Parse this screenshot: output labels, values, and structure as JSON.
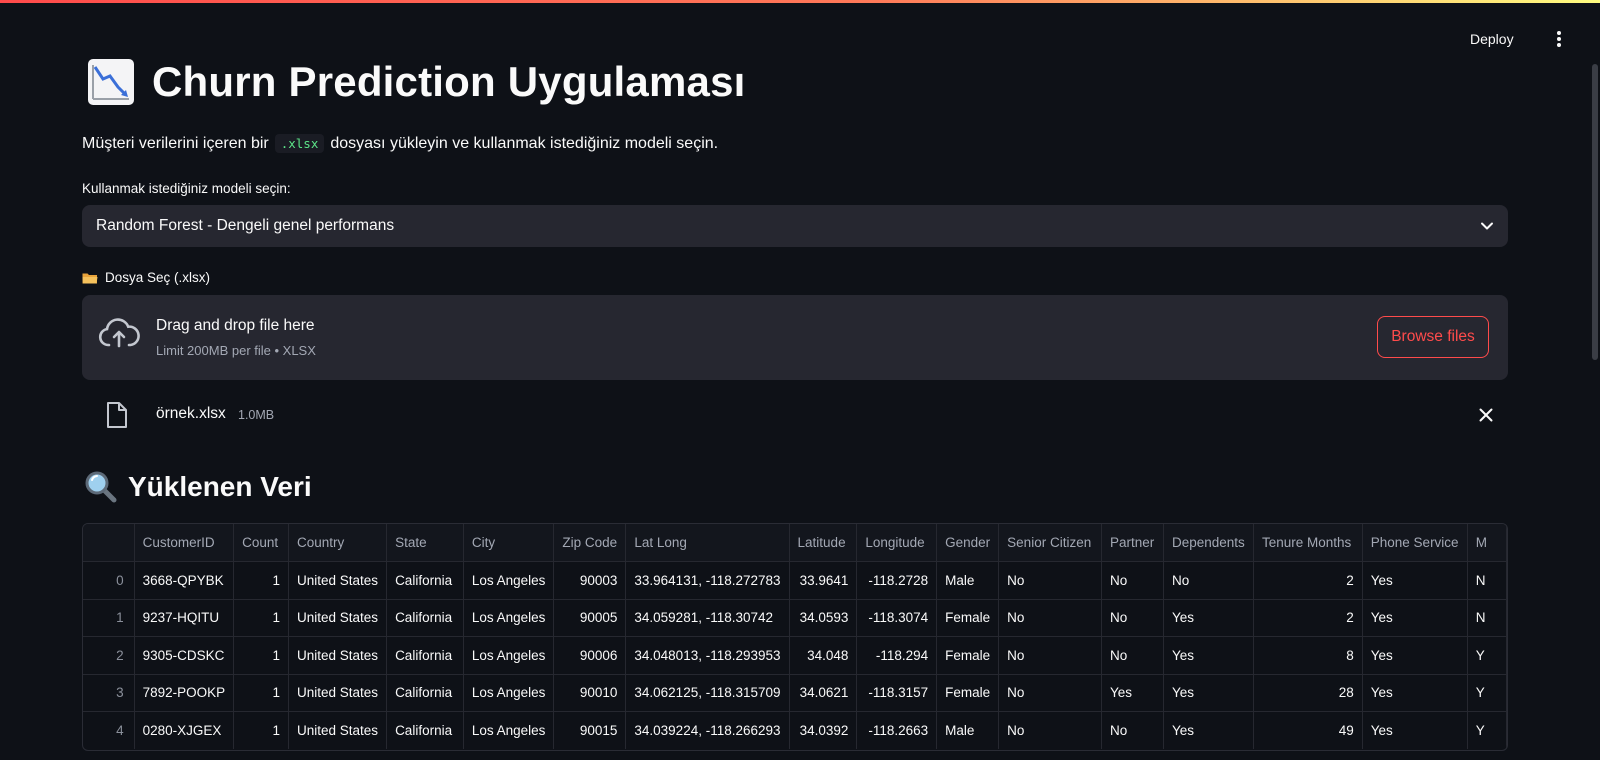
{
  "header": {
    "deploy_label": "Deploy"
  },
  "page": {
    "title": "Churn Prediction Uygulaması",
    "description_before": "Müşteri verilerini içeren bir",
    "description_code": ".xlsx",
    "description_after": "dosyası yükleyin ve kullanmak istediğiniz modeli seçin."
  },
  "model_select": {
    "label": "Kullanmak istediğiniz modeli seçin:",
    "selected": "Random Forest - Dengeli genel performans"
  },
  "uploader": {
    "label": "Dosya Seç (.xlsx)",
    "drop_title": "Drag and drop file here",
    "drop_sub": "Limit 200MB per file • XLSX",
    "browse_label": "Browse files",
    "file_name": "örnek.xlsx",
    "file_size": "1.0MB"
  },
  "data_section": {
    "title": "Yüklenen Veri"
  },
  "table": {
    "columns": [
      "",
      "CustomerID",
      "Count",
      "Country",
      "State",
      "City",
      "Zip Code",
      "Lat Long",
      "Latitude",
      "Longitude",
      "Gender",
      "Senior Citizen",
      "Partner",
      "Dependents",
      "Tenure Months",
      "Phone Service",
      "M"
    ],
    "rows": [
      [
        "0",
        "3668-QPYBK",
        "1",
        "United States",
        "California",
        "Los Angeles",
        "90003",
        "33.964131, -118.272783",
        "33.9641",
        "-118.2728",
        "Male",
        "No",
        "No",
        "No",
        "2",
        "Yes",
        "N"
      ],
      [
        "1",
        "9237-HQITU",
        "1",
        "United States",
        "California",
        "Los Angeles",
        "90005",
        "34.059281, -118.30742",
        "34.0593",
        "-118.3074",
        "Female",
        "No",
        "No",
        "Yes",
        "2",
        "Yes",
        "N"
      ],
      [
        "2",
        "9305-CDSKC",
        "1",
        "United States",
        "California",
        "Los Angeles",
        "90006",
        "34.048013, -118.293953",
        "34.048",
        "-118.294",
        "Female",
        "No",
        "No",
        "Yes",
        "8",
        "Yes",
        "Y"
      ],
      [
        "3",
        "7892-POOKP",
        "1",
        "United States",
        "California",
        "Los Angeles",
        "90010",
        "34.062125, -118.315709",
        "34.0621",
        "-118.3157",
        "Female",
        "No",
        "Yes",
        "Yes",
        "28",
        "Yes",
        "Y"
      ],
      [
        "4",
        "0280-XJGEX",
        "1",
        "United States",
        "California",
        "Los Angeles",
        "90015",
        "34.039224, -118.266293",
        "34.0392",
        "-118.2663",
        "Male",
        "No",
        "No",
        "Yes",
        "49",
        "Yes",
        "Y"
      ]
    ]
  },
  "colors": {
    "background": "#0e1117",
    "widget": "#262730",
    "accent": "#ff4b4b",
    "code_text": "#5ce488"
  },
  "icons": {
    "title_icon": "chart-decreasing-icon",
    "upload_label_icon": "folder-icon",
    "dropzone_icon": "cloud-upload-icon",
    "file_icon": "file-icon",
    "remove_icon": "close-icon",
    "section_icon": "magnifier-icon",
    "select_icon": "chevron-down-icon",
    "menu_icon": "kebab-menu-icon"
  }
}
